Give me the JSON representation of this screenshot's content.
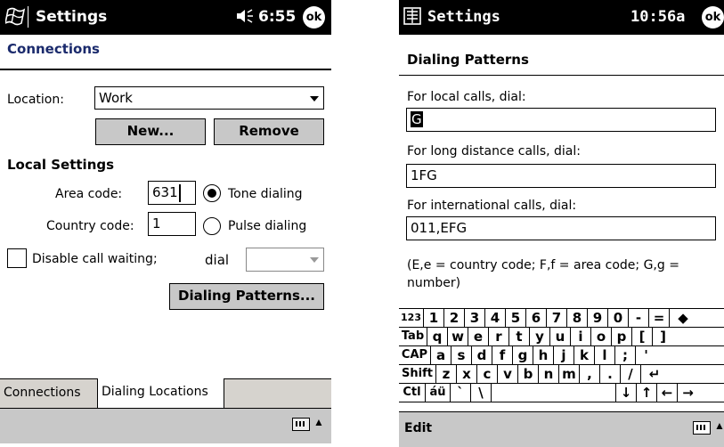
{
  "left": {
    "title": "Settings",
    "time": "6:55",
    "ok_label": "ok",
    "section_header": "Connections",
    "location_label": "Location:",
    "location_value": "Work",
    "new_button": "New...",
    "remove_button": "Remove",
    "local_settings_header": "Local Settings",
    "area_code_label": "Area code:",
    "area_code_value": "631",
    "country_code_label": "Country code:",
    "country_code_value": "1",
    "tone_dialing_label": "Tone dialing",
    "pulse_dialing_label": "Pulse dialing",
    "tone_selected": true,
    "disable_call_waiting_label": "Disable call waiting;",
    "dial_label": "dial",
    "dial_value": "",
    "dialing_patterns_button": "Dialing Patterns...",
    "tabs": [
      {
        "label": "Connections",
        "active": false
      },
      {
        "label": "Dialing Locations",
        "active": true
      }
    ]
  },
  "right": {
    "title": "Settings",
    "time": "10:56a",
    "ok_label": "ok",
    "section_header": "Dialing Patterns",
    "local_label": "For local calls, dial:",
    "local_value": "G",
    "long_distance_label": "For long distance calls, dial:",
    "long_distance_value": "1FG",
    "international_label": "For international calls, dial:",
    "international_value": "011,EFG",
    "legend_line1": "(E,e = country code; F,f = area code; G,g =",
    "legend_line2": "number)",
    "menu_edit": "Edit",
    "keyboard": {
      "row1": [
        "123",
        "1",
        "2",
        "3",
        "4",
        "5",
        "6",
        "7",
        "8",
        "9",
        "0",
        "-",
        "=",
        "◆"
      ],
      "row2": [
        "Tab",
        "q",
        "w",
        "e",
        "r",
        "t",
        "y",
        "u",
        "i",
        "o",
        "p",
        "[",
        "]"
      ],
      "row3": [
        "CAP",
        "a",
        "s",
        "d",
        "f",
        "g",
        "h",
        "j",
        "k",
        "l",
        ";",
        "'"
      ],
      "row4": [
        "Shift",
        "z",
        "x",
        "c",
        "v",
        "b",
        "n",
        "m",
        ",",
        ".",
        "/",
        "↵"
      ],
      "row5": [
        "Ctl",
        "áü",
        "`",
        "\\",
        "",
        "↓",
        "↑",
        "←",
        "→"
      ]
    }
  },
  "icons": {
    "start": "windows-flag-icon",
    "volume": "speaker-icon",
    "keyboard": "keyboard-icon",
    "up": "up-arrow-icon"
  },
  "colors": {
    "titlebar": "#000000",
    "header_text": "#1a2a6c",
    "button_bg": "#c8c8c8",
    "tabbar_bg": "#d6d3ce"
  }
}
